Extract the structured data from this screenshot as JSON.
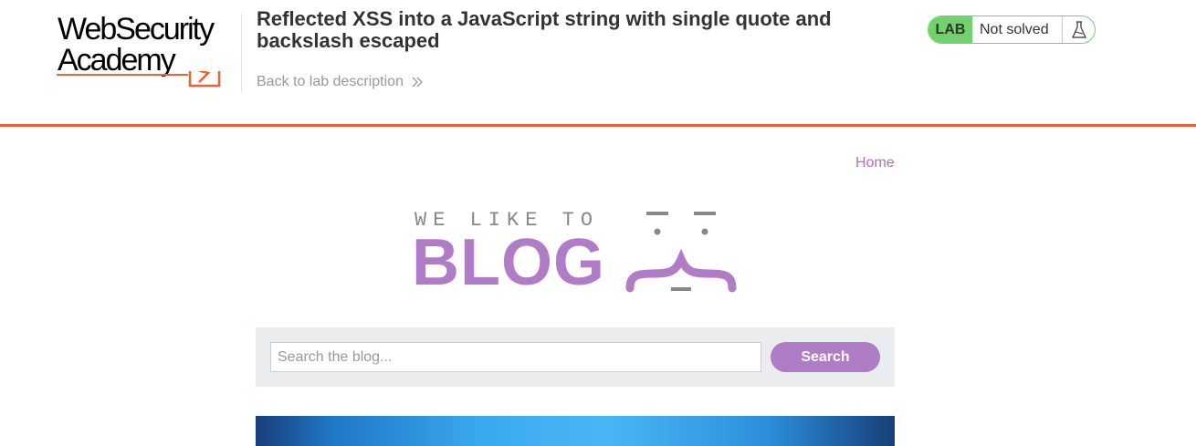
{
  "header": {
    "logo_line1": "WebSecurity",
    "logo_line2": "Academy",
    "lab_title": "Reflected XSS into a JavaScript string with single quote and backslash escaped",
    "back_link": "Back to lab description",
    "lab_badge": "LAB",
    "lab_status": "Not solved"
  },
  "nav": {
    "home": "Home"
  },
  "blog": {
    "tagline": "WE LIKE TO",
    "title": "BLOG"
  },
  "search": {
    "placeholder": "Search the blog...",
    "value": "",
    "button_label": "Search"
  },
  "colors": {
    "accent_orange": "#ee6135",
    "accent_purple": "#b07cc6",
    "status_green": "#70d16d"
  },
  "icons": {
    "back": "chevron-double-right-icon",
    "lab_status": "flask-icon",
    "academy_logo": "lightning-bolt-icon"
  }
}
